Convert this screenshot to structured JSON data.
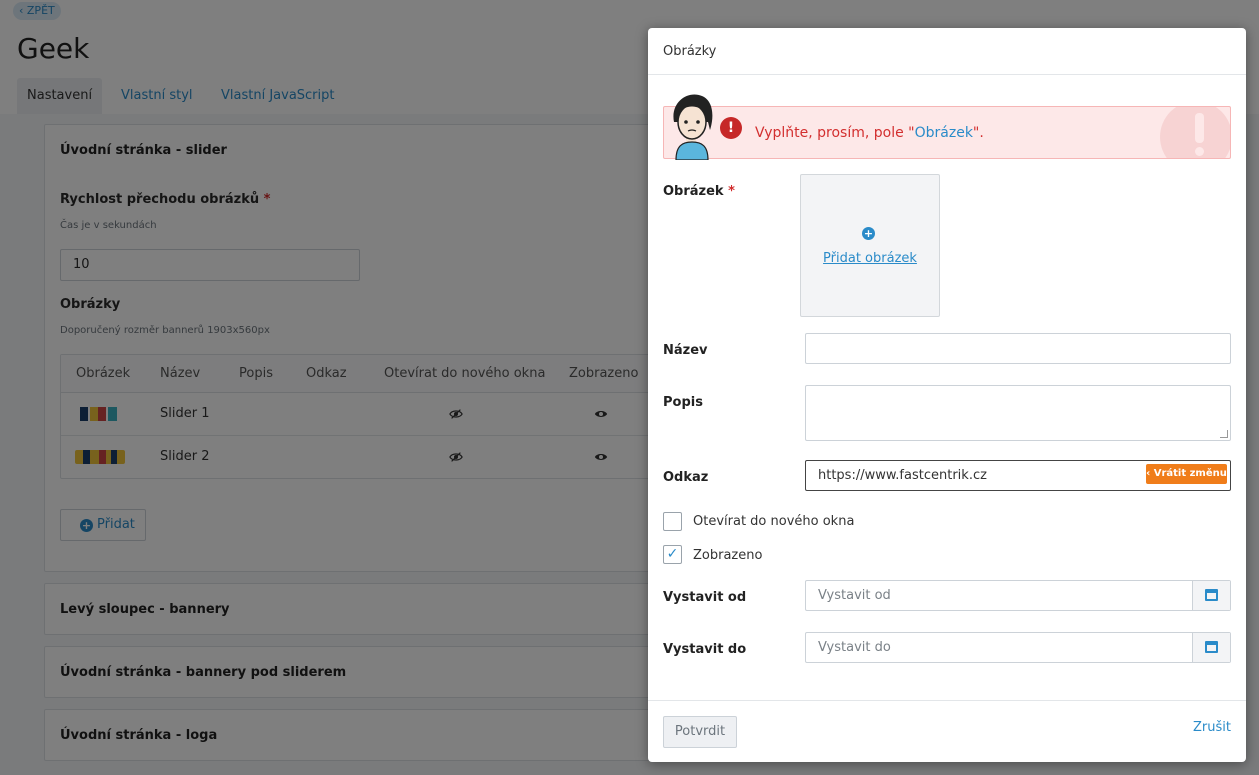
{
  "page": {
    "back_label": "‹ ZPĚT",
    "title": "Geek",
    "tabs": [
      "Nastavení",
      "Vlastní styl",
      "Vlastní JavaScript"
    ]
  },
  "slider_section": {
    "title": "Úvodní stránka - slider",
    "speed_label": "Rychlost přechodu obrázků",
    "required_mark": "*",
    "speed_hint": "Čas je v sekundách",
    "speed_value": "10",
    "images_label": "Obrázky",
    "images_hint": "Doporučený rozměr bannerů 1903x560px",
    "table_headers": [
      "Obrázek",
      "Název",
      "Popis",
      "Odkaz",
      "Otevírat do nového okna",
      "Zobrazeno"
    ],
    "rows": [
      {
        "name": "Slider 1",
        "new_window_icon": "eye-slash-icon",
        "visible_icon": "eye-icon"
      },
      {
        "name": "Slider 2",
        "new_window_icon": "eye-slash-icon",
        "visible_icon": "eye-icon"
      }
    ],
    "add_label": "Přidat"
  },
  "collapsed_sections": [
    "Levý sloupec - bannery",
    "Úvodní stránka - bannery pod sliderem",
    "Úvodní stránka - loga"
  ],
  "modal": {
    "title": "Obrázky",
    "alert": {
      "prefix": "Vyplňte, prosím, pole \"",
      "field": "Obrázek",
      "suffix": "\".",
      "icon": "exclamation-icon"
    },
    "image_label": "Obrázek",
    "image_required": "*",
    "add_image_label": "Přidat obrázek",
    "name_label": "Název",
    "name_value": "",
    "description_label": "Popis",
    "link_label": "Odkaz",
    "link_value": "https://www.fastcentrik.cz",
    "revert_label": "‹ Vrátit změnu",
    "new_window_label": "Otevírat do nového okna",
    "new_window_checked": false,
    "visible_label": "Zobrazeno",
    "visible_checked": true,
    "publish_from_label": "Vystavit od",
    "publish_from_placeholder": "Vystavit od",
    "publish_to_label": "Vystavit do",
    "publish_to_placeholder": "Vystavit do",
    "confirm_label": "Potvrdit",
    "cancel_label": "Zrušit"
  },
  "colors": {
    "accent": "#2a8bc9",
    "error": "#d32f2f",
    "warning_button": "#f07d1a"
  }
}
